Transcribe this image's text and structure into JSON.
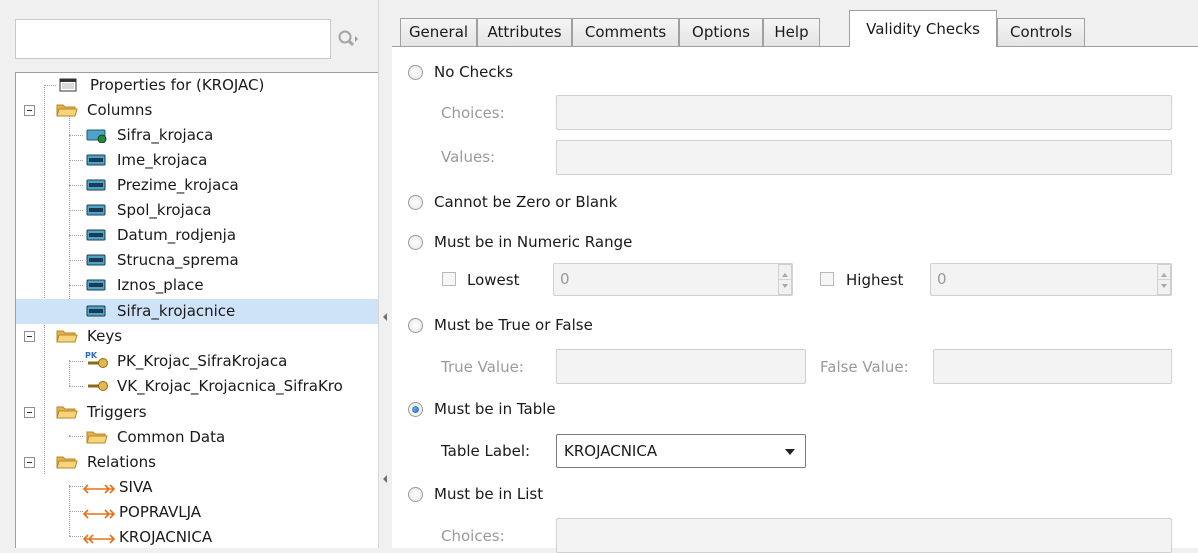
{
  "search": {
    "value": "",
    "placeholder": ""
  },
  "tree": {
    "properties": "Properties for (KROJAC)",
    "columns_label": "Columns",
    "columns": [
      "Sifra_krojaca",
      "Ime_krojaca",
      "Prezime_krojaca",
      "Spol_krojaca",
      "Datum_rodjenja",
      "Strucna_sprema",
      "Iznos_place",
      "Sifra_krojacnice"
    ],
    "keys_label": "Keys",
    "keys": [
      "PK_Krojac_SifraKrojaca",
      "VK_Krojac_Krojacnica_SifraKro"
    ],
    "triggers_label": "Triggers",
    "triggers": [
      "Common Data"
    ],
    "relations_label": "Relations",
    "relations": [
      "SIVA",
      "POPRAVLJA",
      "KROJACNICA"
    ]
  },
  "tabs": [
    "General",
    "Attributes",
    "Comments",
    "Options",
    "Help",
    "Validity Checks",
    "Controls"
  ],
  "active_tab": "Validity Checks",
  "validity": {
    "no_checks": "No Checks",
    "choices_label": "Choices:",
    "values_label": "Values:",
    "cannot_zero": "Cannot be Zero or Blank",
    "numeric_range": "Must be in Numeric Range",
    "lowest_label": "Lowest",
    "lowest_value": "0",
    "highest_label": "Highest",
    "highest_value": "0",
    "true_false": "Must be True or False",
    "true_value_label": "True Value:",
    "false_value_label": "False Value:",
    "in_table": "Must be in Table",
    "table_label": "Table Label:",
    "table_value": "KROJACNICA",
    "in_list": "Must be in List",
    "list_choices_label": "Choices:",
    "selected_option": "Must be in Table"
  },
  "colors": {
    "selection": "#cce8ff",
    "folder": "#f2c55c",
    "relation_arrow": "#e8701a",
    "radio_dot": "#1c5eab"
  }
}
